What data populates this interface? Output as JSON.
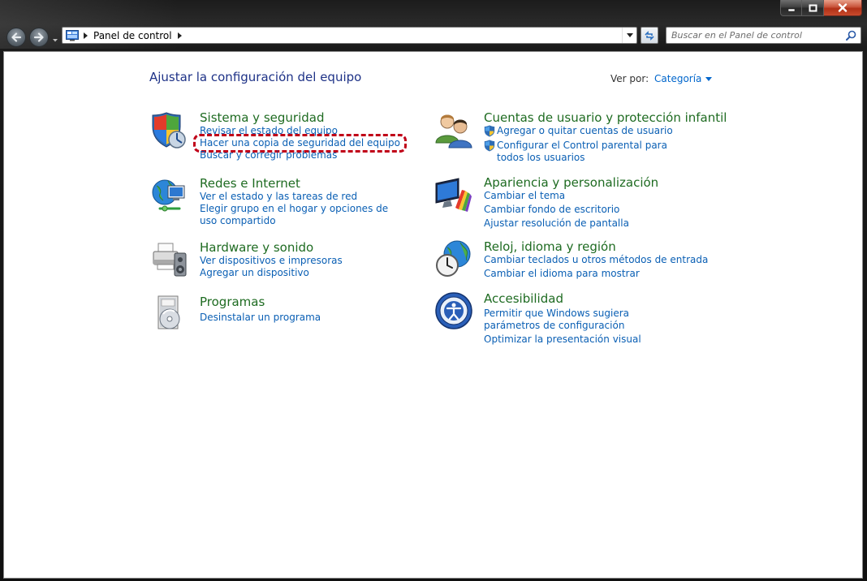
{
  "window": {
    "address": {
      "crumbs": [
        "Panel de control"
      ]
    },
    "search": {
      "placeholder": "Buscar en el Panel de control"
    }
  },
  "page": {
    "title": "Ajustar la configuración del equipo",
    "view_by_label": "Ver por:",
    "view_by_value": "Categoría"
  },
  "categories": [
    {
      "title": "Sistema y seguridad",
      "icon": "security-shield-icon",
      "links": [
        "Revisar el estado del equipo",
        "Hacer una copia de seguridad del equipo",
        "Buscar y corregir problemas"
      ]
    },
    {
      "title": "Redes e Internet",
      "icon": "network-globe-icon",
      "links": [
        "Ver el estado y las tareas de red",
        "Elegir grupo en el hogar y opciones de uso compartido"
      ]
    },
    {
      "title": "Hardware y sonido",
      "icon": "printer-speaker-icon",
      "links": [
        "Ver dispositivos e impresoras",
        "Agregar un dispositivo"
      ]
    },
    {
      "title": "Programas",
      "icon": "programs-disc-icon",
      "links": [
        "Desinstalar un programa"
      ]
    },
    {
      "title": "Cuentas de usuario y protección infantil",
      "icon": "users-icon",
      "links": [
        "Agregar o quitar cuentas de usuario",
        "Configurar el Control parental para todos los usuarios"
      ]
    },
    {
      "title": "Apariencia y personalización",
      "icon": "display-palette-icon",
      "links": [
        "Cambiar el tema",
        "Cambiar fondo de escritorio",
        "Ajustar resolución de pantalla"
      ]
    },
    {
      "title": "Reloj, idioma y región",
      "icon": "clock-globe-icon",
      "links": [
        "Cambiar teclados u otros métodos de entrada",
        "Cambiar el idioma para mostrar"
      ]
    },
    {
      "title": "Accesibilidad",
      "icon": "accessibility-icon",
      "links": [
        "Permitir que Windows sugiera parámetros de configuración",
        "Optimizar la presentación visual"
      ]
    }
  ],
  "colors": {
    "category_title": "#1e6b21",
    "link": "#0a5fb4",
    "page_title": "#1e3287",
    "highlight": "#c00018"
  }
}
